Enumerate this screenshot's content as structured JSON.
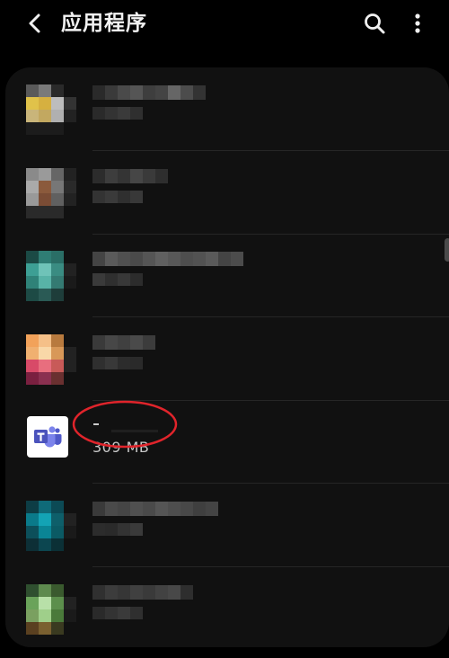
{
  "header": {
    "title": "应用程序",
    "back_icon": "chevron-left-icon",
    "search_icon": "search-icon",
    "more_icon": "more-vertical-icon"
  },
  "apps": [
    {
      "name_visible": "",
      "size": "",
      "blurred": true,
      "icon_colors": [
        "#5a5a5a",
        "#7a7a7a",
        "#2a2a2a",
        "#111",
        "#e0c24a",
        "#d6b040",
        "#bdbdbd",
        "#333",
        "#c9b57a",
        "#c2a860",
        "#b0b0b0",
        "#222",
        "#1c1c1c",
        "#1c1c1c",
        "#1c1c1c",
        "#111"
      ]
    },
    {
      "name_visible": "",
      "size": "",
      "blurred": true,
      "icon_colors": [
        "#8a8a8a",
        "#9a9a9a",
        "#666",
        "#222",
        "#aaaaaa",
        "#8b5a3c",
        "#777",
        "#2a2a2a",
        "#999",
        "#7a4c35",
        "#606060",
        "#222",
        "#2a2a2a",
        "#2a2a2a",
        "#2a2a2a",
        "#111"
      ]
    },
    {
      "name_visible": "",
      "size": "",
      "blurred": true,
      "icon_colors": [
        "#1b4a45",
        "#2f7d74",
        "#2a6e66",
        "#111",
        "#3d9f94",
        "#6fc3b8",
        "#3a8c82",
        "#222",
        "#2f8278",
        "#58b3a7",
        "#347a72",
        "#1a1a1a",
        "#1d4a45",
        "#2a5a55",
        "#1e3d3a",
        "#111"
      ]
    },
    {
      "name_visible": "",
      "size": "",
      "blurred": true,
      "icon_colors": [
        "#f2a25a",
        "#f5c088",
        "#b87a3e",
        "#111",
        "#f0b070",
        "#f9d8a8",
        "#d89858",
        "#222",
        "#d84a68",
        "#e86e7e",
        "#c85a58",
        "#222",
        "#7a2040",
        "#8a3050",
        "#6a3030",
        "#111"
      ]
    },
    {
      "name_visible": "",
      "size": "309 MB",
      "blurred": false,
      "icon": "teams-icon"
    },
    {
      "name_visible": "",
      "size": "",
      "blurred": true,
      "icon_colors": [
        "#0d3d45",
        "#0f6a78",
        "#0c4a55",
        "#111",
        "#0a7a8a",
        "#13a3b5",
        "#0e5f6a",
        "#222",
        "#0c4f5a",
        "#0a8595",
        "#0b5a64",
        "#1a1a1a",
        "#0d2f36",
        "#0c4650",
        "#0b3036",
        "#111"
      ]
    },
    {
      "name_visible": "",
      "size": "",
      "blurred": true,
      "icon_colors": [
        "#2f4f2f",
        "#5e8a4e",
        "#3a5a2e",
        "#111",
        "#6aa35a",
        "#b8e0a8",
        "#5c8f4c",
        "#222",
        "#7aa060",
        "#9fcf8a",
        "#4a7a3a",
        "#1a1a1a",
        "#5a4020",
        "#7a6030",
        "#3a3a20",
        "#111"
      ]
    }
  ],
  "accent": {
    "annotation": "#e0242b",
    "divider": "#262626",
    "card": "#111111"
  }
}
